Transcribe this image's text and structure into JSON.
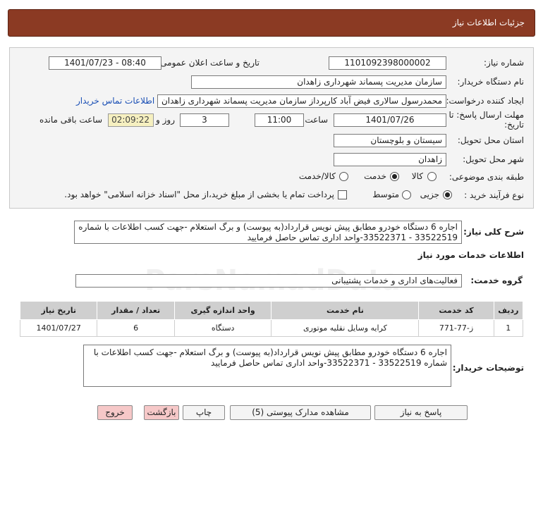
{
  "header": {
    "title": "جزئیات اطلاعات نیاز"
  },
  "form": {
    "need_number_label": "شماره نیاز:",
    "need_number": "1101092398000002",
    "announce_label": "تاریخ و ساعت اعلان عمومی:",
    "announce_value": "1401/07/23 - 08:40",
    "buyer_org_label": "نام دستگاه خریدار:",
    "buyer_org": "سازمان مدیریت پسماند شهرداری زاهدان",
    "creator_label": "ایجاد کننده درخواست:",
    "creator": "محمدرسول سالاری فیض آباد کارپرداز سازمان مدیریت پسماند شهرداری زاهدان",
    "contact_link": "اطلاعات تماس خریدار",
    "deadline_label_1": "مهلت ارسال پاسخ: تا",
    "deadline_label_2": "تاریخ:",
    "deadline_date": "1401/07/26",
    "time_label": "ساعت",
    "deadline_time": "11:00",
    "days_value": "3",
    "days_label": "روز و",
    "remaining_time": "02:09:22",
    "remaining_label": "ساعت باقی مانده",
    "province_label": "استان محل تحویل:",
    "province": "سیستان و بلوچستان",
    "city_label": "شهر محل تحویل:",
    "city": "زاهدان",
    "category_label": "طبقه بندی موضوعی:",
    "category_options": [
      "کالا",
      "خدمت",
      "کالا/خدمت"
    ],
    "category_selected": "خدمت",
    "process_label": "نوع فرآیند خرید :",
    "process_options": [
      "جزیی",
      "متوسط"
    ],
    "process_selected": "جزیی",
    "treasury_note": "پرداخت تمام یا بخشی از مبلغ خرید،از محل \"اسناد خزانه اسلامی\" خواهد بود."
  },
  "summary": {
    "label": "شرح کلی نیاز:",
    "text": "اجاره 6 دستگاه خودرو مطابق پیش نویس قرارداد(به پیوست) و برگ استعلام -جهت کسب اطلاعات با شماره 33522519 - 33522371-واحد اداری تماس حاصل فرمایید"
  },
  "services": {
    "section_title": "اطلاعات خدمات مورد نیاز",
    "group_label": "گروه خدمت:",
    "group_value": "فعالیت‌های اداری و خدمات پشتیبانی"
  },
  "table": {
    "headers": [
      "ردیف",
      "کد خدمت",
      "نام خدمت",
      "واحد اندازه گیری",
      "تعداد / مقدار",
      "تاریخ نیاز"
    ],
    "rows": [
      [
        "1",
        "ز-77-771",
        "کرایه وسایل نقلیه موتوری",
        "دستگاه",
        "6",
        "1401/07/27"
      ]
    ]
  },
  "buyer_notes": {
    "label": "توضیحات خریدار:",
    "text": "اجاره 6 دستگاه خودرو مطابق پیش نویس قرارداد(به پیوست) و برگ استعلام -جهت کسب اطلاعات با شماره 33522519 - 33522371-واحد اداری تماس حاصل فرمایید"
  },
  "buttons": {
    "reply": "پاسخ به نیاز",
    "attachments": "مشاهده مدارک پیوستی (5)",
    "print": "چاپ",
    "back": "بازگشت",
    "exit": "خروج"
  },
  "colors": {
    "header_bg": "#8b3a23",
    "panel_bg": "#f4f4f4",
    "remaining_bg": "#f6f0c0",
    "link": "#1a4fb5",
    "pink_button": "#f6c8c8"
  }
}
